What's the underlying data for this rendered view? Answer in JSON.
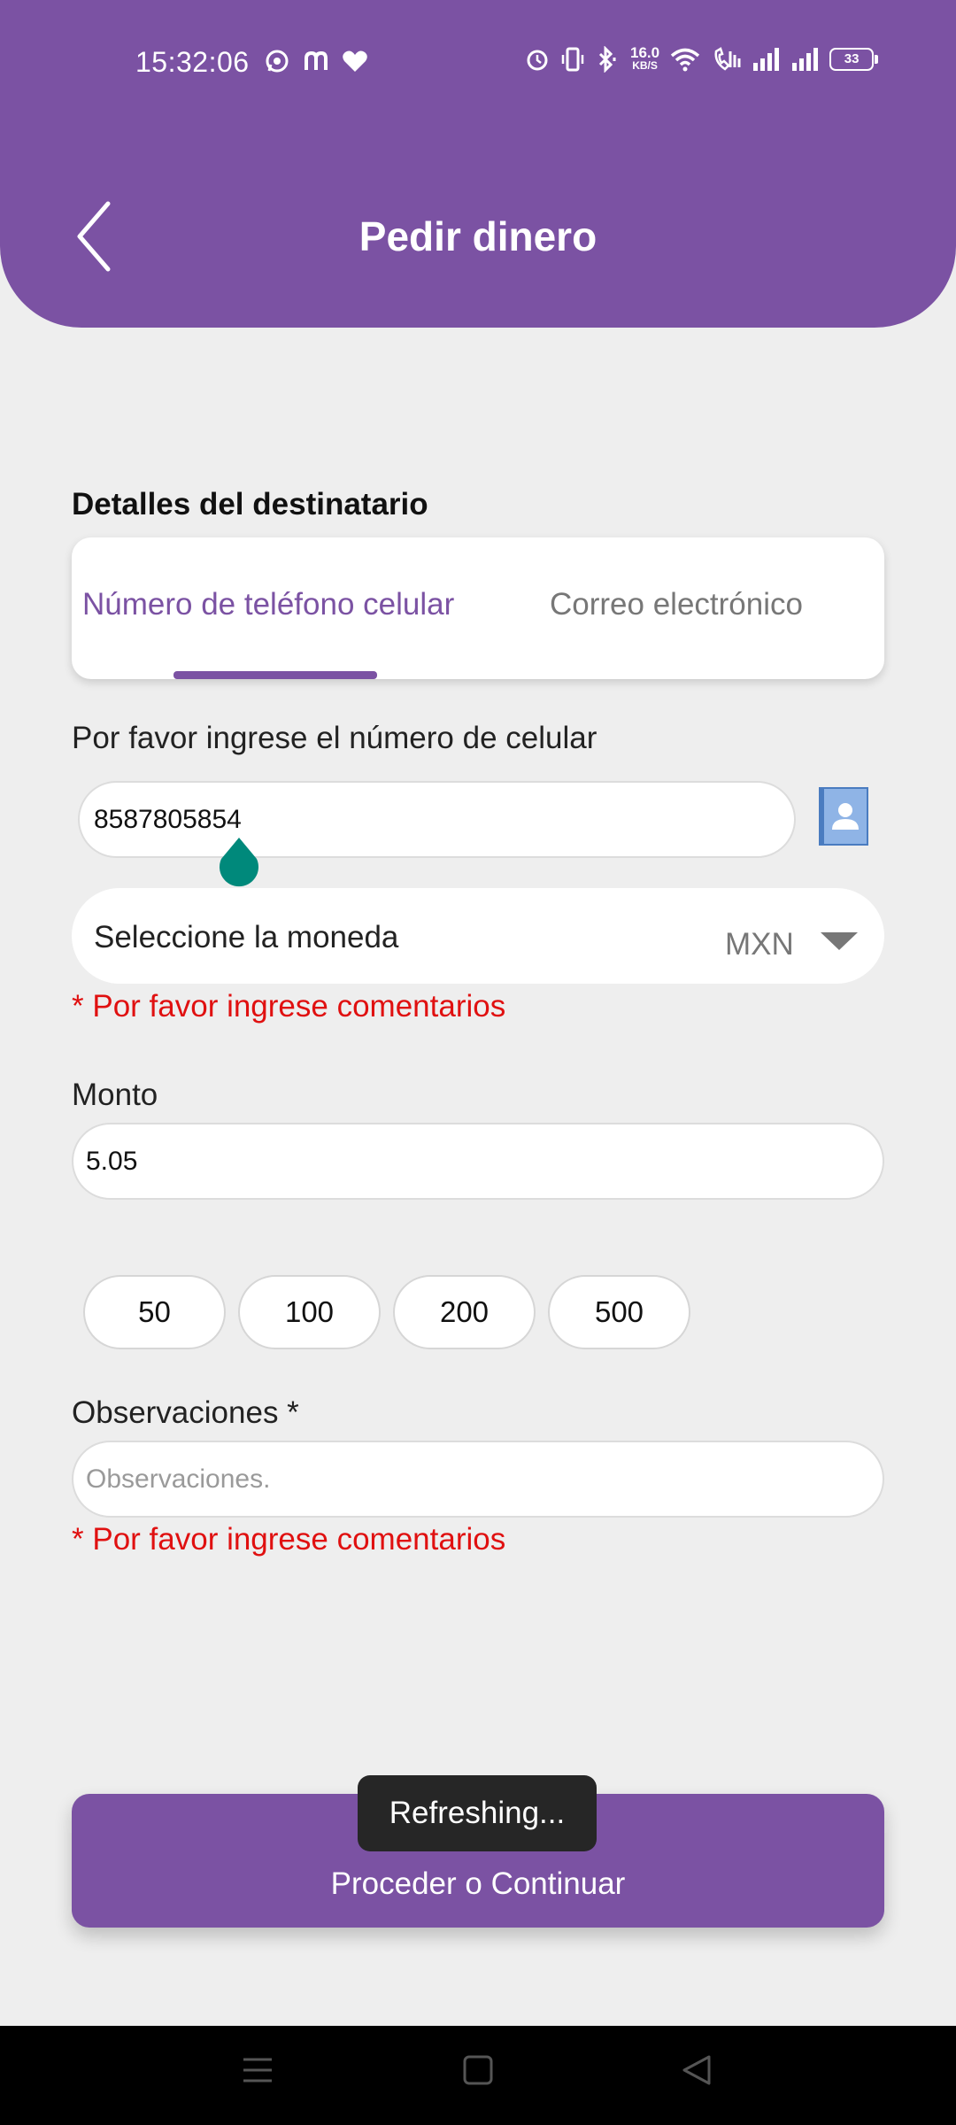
{
  "status_bar": {
    "time": "15:32:06",
    "net_speed_value": "16.0",
    "net_speed_unit": "KB/S",
    "battery": "33",
    "icons": [
      "whatsapp-icon",
      "m-app-icon",
      "heart-icon",
      "alarm-icon",
      "vibrate-icon",
      "bluetooth-icon",
      "wifi-icon",
      "wifi-calling-icon",
      "signal-icon",
      "signal-icon"
    ]
  },
  "header": {
    "title": "Pedir dinero",
    "back_icon": "chevron-left-icon",
    "color": "#7b52a3"
  },
  "recipient": {
    "section_title": "Detalles del destinatario",
    "tabs": [
      {
        "label": "Número de teléfono celular",
        "active": true
      },
      {
        "label": "Correo electrónico",
        "active": false
      }
    ]
  },
  "phone": {
    "label": "Por favor ingrese el número de celular",
    "value": "8587805854",
    "contact_icon": "contact-book-icon"
  },
  "currency": {
    "label": "Seleccione la moneda",
    "value": "MXN",
    "error": "* Por favor ingrese comentarios"
  },
  "amount": {
    "label": "Monto",
    "value": "5.05",
    "quick_amounts": [
      "50",
      "100",
      "200",
      "500"
    ]
  },
  "observations": {
    "label": "Observaciones *",
    "placeholder": "Observaciones.",
    "error": "* Por favor ingrese comentarios"
  },
  "actions": {
    "proceed_label": "Proceder o Continuar"
  },
  "toast": {
    "text": "Refreshing..."
  },
  "colors": {
    "primary": "#7b52a3",
    "error": "#e01010",
    "accent_handle": "#00897b"
  },
  "nav_bar": {
    "icons": [
      "menu-icon",
      "home-icon",
      "back-triangle-icon"
    ]
  }
}
